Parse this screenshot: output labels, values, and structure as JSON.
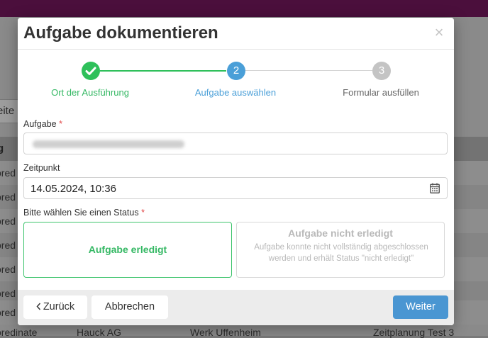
{
  "background": {
    "tab_label": "eite",
    "header_label": "g",
    "rows": [
      "ored",
      "ored",
      "ored",
      "ored",
      "ored",
      "ored",
      "ored"
    ],
    "last_row": {
      "col1": "oredinate",
      "col2": "Hauck AG",
      "col3": "Werk Uffenheim",
      "col4": "Zeitplanung Test 3"
    }
  },
  "modal": {
    "title": "Aufgabe dokumentieren",
    "close_symbol": "×",
    "steps": [
      {
        "number": "✓",
        "label": "Ort der Ausführung",
        "state": "done",
        "color": "#2ec05a"
      },
      {
        "number": "2",
        "label": "Aufgabe auswählen",
        "state": "active",
        "color": "#4a9fd8"
      },
      {
        "number": "3",
        "label": "Formular ausfüllen",
        "state": "pending",
        "color": "#c4c4c4"
      }
    ],
    "task_field": {
      "label": "Aufgabe",
      "required_mark": "*",
      "value_blurred": true
    },
    "time_field": {
      "label": "Zeitpunkt",
      "value": "14.05.2024, 10:36",
      "icon": "calendar-icon"
    },
    "status": {
      "label": "Bitte wählen Sie einen Status",
      "required_mark": "*",
      "done": {
        "title": "Aufgabe erledigt"
      },
      "not_done": {
        "title": "Aufgabe nicht erledigt",
        "description": "Aufgabe konnte nicht vollständig abgeschlossen werden und erhält Status \"nicht erledigt\""
      }
    },
    "footer": {
      "back_label": "Zurück",
      "back_icon": "chevron-left-icon",
      "cancel_label": "Abbrechen",
      "next_label": "Weiter"
    }
  },
  "colors": {
    "accent": "#4a96d2",
    "success": "#35b864",
    "topbar": "#4b0f3c"
  }
}
